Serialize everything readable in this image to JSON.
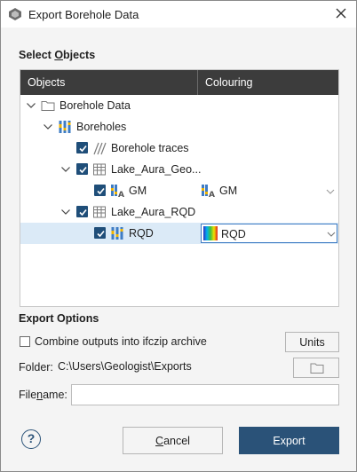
{
  "window": {
    "title": "Export Borehole Data"
  },
  "select_objects": {
    "label_pre": "Select ",
    "label_mn": "O",
    "label_post": "bjects",
    "columns": {
      "objects": "Objects",
      "colouring": "Colouring"
    },
    "tree": {
      "borehole_data": "Borehole Data",
      "boreholes": "Boreholes",
      "borehole_traces": "Borehole traces",
      "lake_geo": "Lake_Aura_Geo...",
      "gm": "GM",
      "gm_colouring": "GM",
      "lake_rqd": "Lake_Aura_RQD",
      "rqd": "RQD",
      "rqd_colouring": "RQD"
    }
  },
  "export_options": {
    "label": "Export Options",
    "combine_label": "Combine outputs into ifczip archive",
    "units_button": "Units",
    "folder_label": "Folder:",
    "folder_path": "C:\\Users\\Geologist\\Exports",
    "filename_label_pre": "File",
    "filename_label_mn": "n",
    "filename_label_post": "ame:",
    "filename_value": ""
  },
  "footer": {
    "help": "?",
    "cancel": "Cancel",
    "export": "Export"
  },
  "colors": {
    "accent": "#2a5278",
    "header_bg": "#3c3c3c",
    "selection": "#dbeaf7",
    "checkbox": "#1f4e79"
  }
}
